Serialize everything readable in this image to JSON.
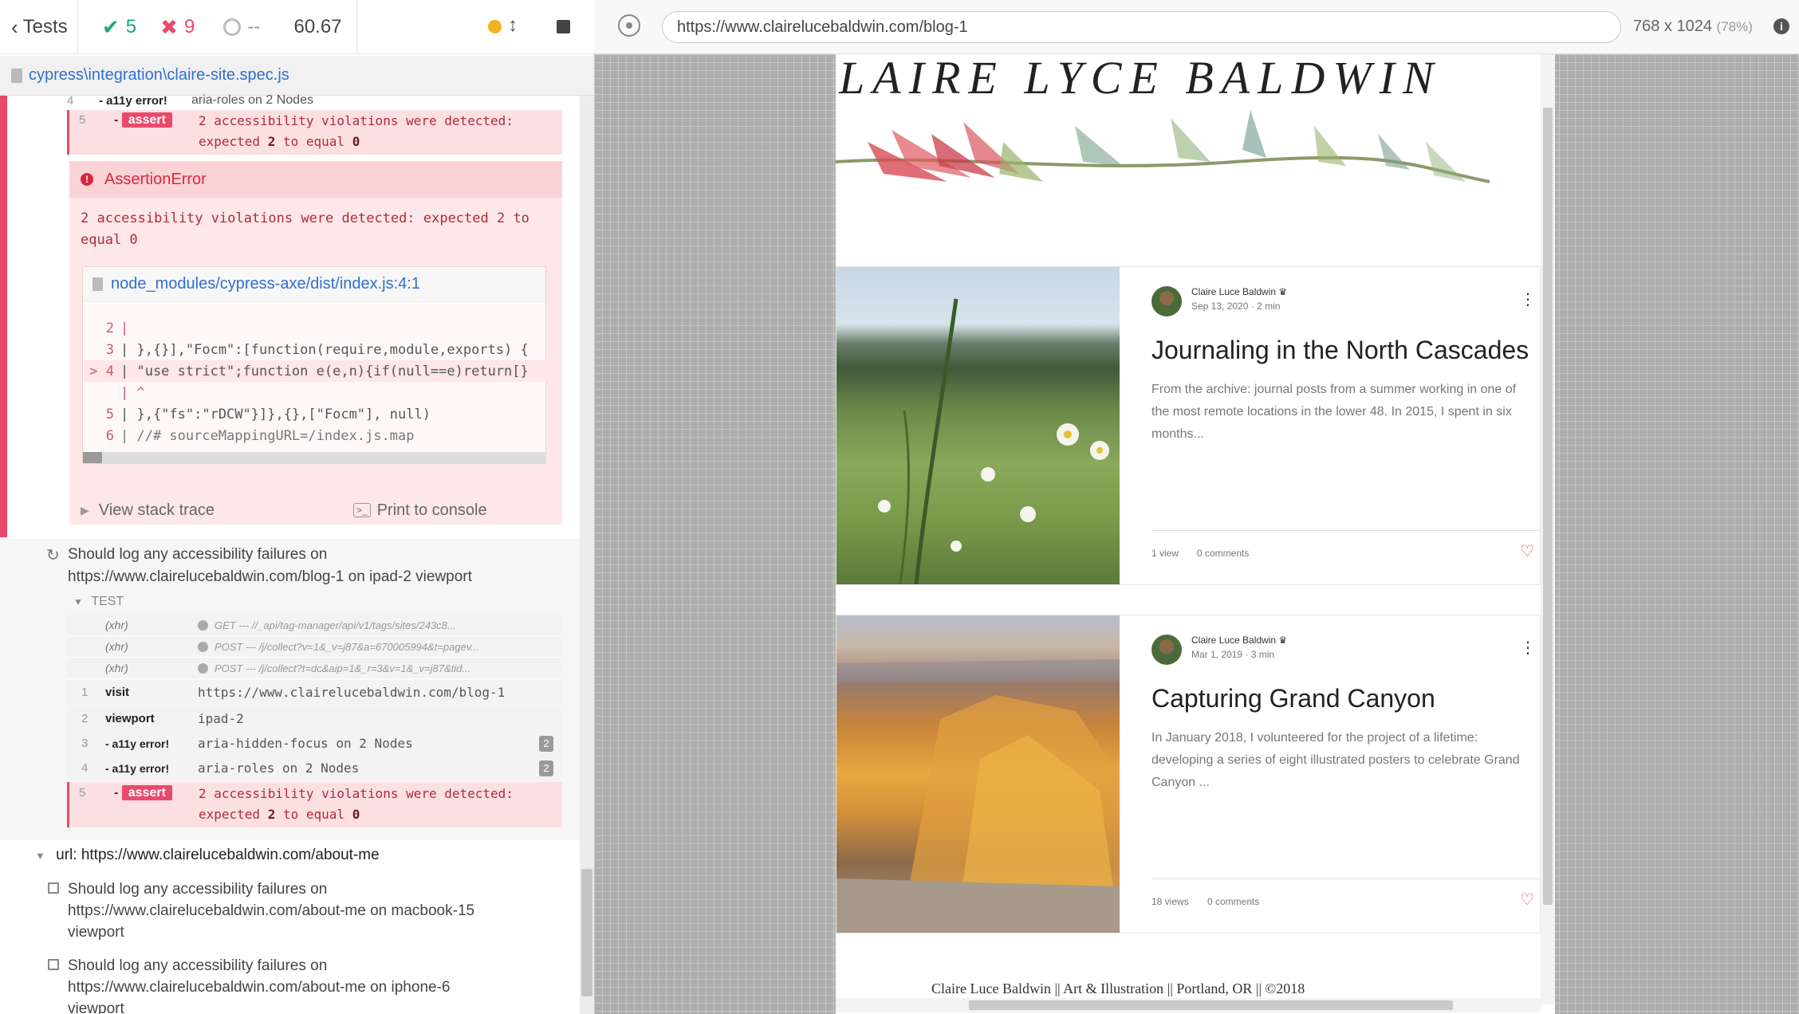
{
  "stats": {
    "tests_label": "Tests",
    "passed": "5",
    "failed": "9",
    "pending": "--",
    "duration": "60.67"
  },
  "spec_file": "cypress\\integration\\claire-site.spec.js",
  "top_block": {
    "row4": {
      "num": "4",
      "name": "- a11y error!",
      "msg": "aria-roles on 2 Nodes"
    },
    "row5": {
      "num": "5",
      "name": "assert",
      "msg1": "2 accessibility violations were detected:",
      "msg2_pre": "expected",
      "msg2_a": "2",
      "msg2_mid": "to equal",
      "msg2_b": "0"
    }
  },
  "error": {
    "title": "AssertionError",
    "message_line1": "2 accessibility violations were detected: expected 2 to",
    "message_line2": "equal 0",
    "file": "node_modules/cypress-axe/dist/index.js:4:1",
    "code": [
      {
        "ln": "2",
        "text": "|"
      },
      {
        "ln": "3",
        "text": "| },{}],\"Focm\":[function(require,module,exports) {"
      },
      {
        "ln": "> 4",
        "text": "| \"use strict\";function e(e,n){if(null==e)return[}"
      },
      {
        "ln": "",
        "text": "|  ^"
      },
      {
        "ln": "5",
        "text": "| },{\"fs\":\"rDCW\"}]},{},[\"Focm\"], null)"
      },
      {
        "ln": "6",
        "text": "| //# sourceMappingURL=/index.js.map"
      }
    ],
    "view_stack": "View stack trace",
    "print_console": "Print to console"
  },
  "test2": {
    "title_line1": "Should log any accessibility failures on",
    "title_line2": "https://www.clairelucebaldwin.com/blog-1 on ipad-2 viewport",
    "section": "TEST",
    "xhr": [
      {
        "k": "(xhr)",
        "v": "GET --- //_api/tag-manager/api/v1/tags/sites/243c8..."
      },
      {
        "k": "(xhr)",
        "v": "POST --- /j/collect?v=1&_v=j87&a=670005994&t=pagev..."
      },
      {
        "k": "(xhr)",
        "v": "POST --- /j/collect?t=dc&aip=1&_r=3&v=1&_v=j87&tid..."
      }
    ],
    "commands": [
      {
        "num": "1",
        "name": "visit",
        "msg": "https://www.clairelucebaldwin.com/blog-1"
      },
      {
        "num": "2",
        "name": "viewport",
        "msg": "ipad-2"
      },
      {
        "num": "3",
        "name": "- a11y error!",
        "msg": "aria-hidden-focus on 2 Nodes",
        "count": "2"
      },
      {
        "num": "4",
        "name": "- a11y error!",
        "msg": "aria-roles on 2 Nodes",
        "count": "2"
      }
    ],
    "assert": {
      "num": "5",
      "name": "assert",
      "msg1": "2 accessibility violations were detected:",
      "msg2_pre": "expected",
      "msg2_a": "2",
      "msg2_mid": "to equal",
      "msg2_b": "0"
    }
  },
  "suite2": {
    "title": "url: https://www.clairelucebaldwin.com/about-me",
    "tests": [
      {
        "l1": "Should log any accessibility failures on",
        "l2": "https://www.clairelucebaldwin.com/about-me on macbook-15",
        "l3": "viewport"
      },
      {
        "l1": "Should log any accessibility failures on",
        "l2": "https://www.clairelucebaldwin.com/about-me on iphone-6",
        "l3": "viewport"
      }
    ]
  },
  "runner": {
    "url": "https://www.clairelucebaldwin.com/blog-1",
    "viewport": "768 x 1024",
    "scale": "(78%)"
  },
  "site": {
    "header_text": "LAIRE LYCE BALDWIN",
    "posts": [
      {
        "author": "Claire Luce Baldwin",
        "date": "Sep 13, 2020",
        "read": "2 min",
        "title": "Journaling in the North Cascades",
        "excerpt": "From the archive: journal posts from a summer working in one of the most remote locations in the lower 48. In 2015, I spent in six months...",
        "views": "1 view",
        "comments": "0 comments"
      },
      {
        "author": "Claire Luce Baldwin",
        "date": "Mar 1, 2019",
        "read": "3 min",
        "title": "Capturing Grand Canyon",
        "excerpt": "In January 2018, I volunteered for the project of a lifetime: developing a series of eight illustrated posters to celebrate Grand Canyon ...",
        "views": "18 views",
        "comments": "0 comments"
      }
    ],
    "footer": "Claire Luce Baldwin || Art & Illustration || Portland, OR || ©2018"
  },
  "colors": {
    "fail": "#e94a6b",
    "pass": "#1aa57a",
    "link": "#2f6fd1"
  }
}
